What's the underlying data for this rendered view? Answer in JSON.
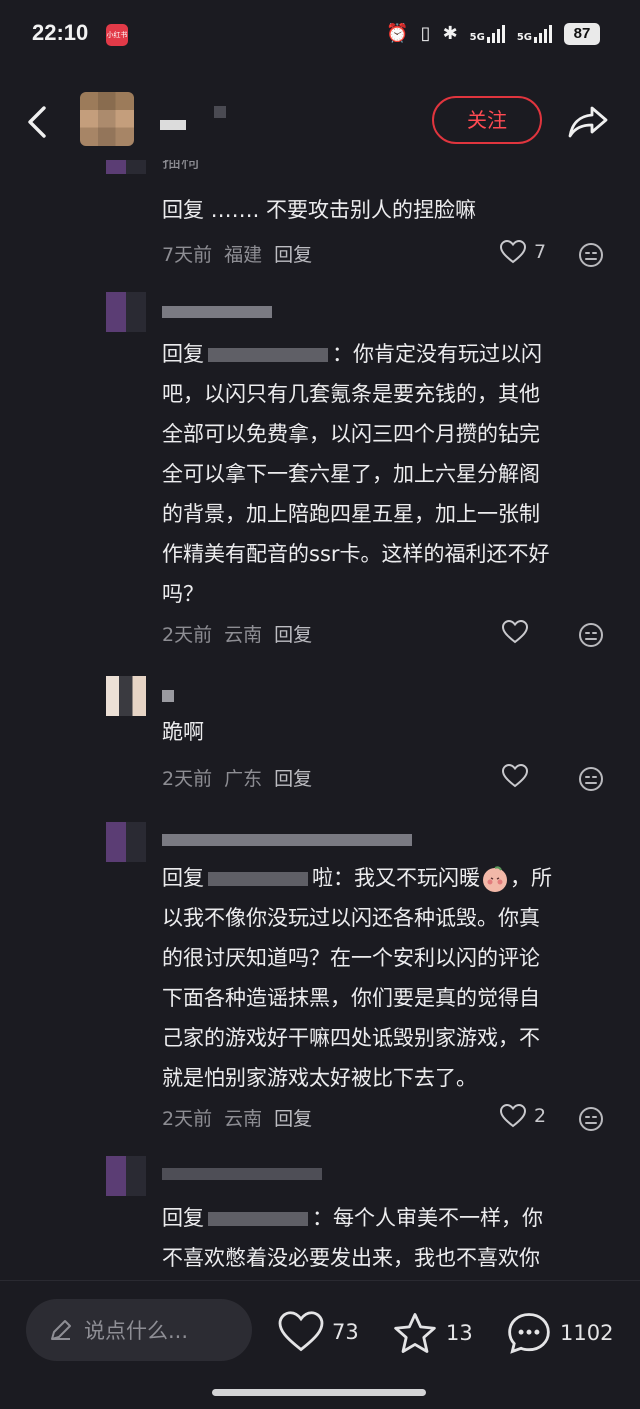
{
  "status_bar": {
    "time": "22:10",
    "app_badge": "小红书",
    "network_1": "5G",
    "network_2": "5G",
    "battery": "87"
  },
  "header": {
    "follow_label": "关注"
  },
  "comments": [
    {
      "name_partial": "插椅",
      "text": "回复 ……. 不要攻击别人的捏脸嘛",
      "time": "7天前",
      "region": "福建",
      "reply_label": "回复",
      "likes": "7"
    },
    {
      "reply_prefix": "回复",
      "reply_suffix": "：你肯定没有玩过以闪",
      "text_lines": [
        "吧，以闪只有几套氪条是要充钱的，其他",
        "全部可以免费拿，以闪三四个月攒的钻完",
        "全可以拿下一套六星了，加上六星分解阁",
        "的背景，加上陪跑四星五星，加上一张制",
        "作精美有配音的ssr卡。这样的福利还不好",
        "吗？"
      ],
      "time": "2天前",
      "region": "云南",
      "reply_label": "回复",
      "likes": ""
    },
    {
      "text": "跪啊",
      "time": "2天前",
      "region": "广东",
      "reply_label": "回复",
      "likes": ""
    },
    {
      "reply_prefix": "回复",
      "reply_suffix": "啦：我又不玩闪暖",
      "reply_tail": "，所",
      "text_lines": [
        "以我不像你没玩过以闪还各种诋毁。你真",
        "的很讨厌知道吗？在一个安利以闪的评论",
        "下面各种造谣抹黑，你们要是真的觉得自",
        "己家的游戏好干嘛四处诋毁别家游戏，不",
        "就是怕别家游戏太好被比下去了。"
      ],
      "time": "2天前",
      "region": "云南",
      "reply_label": "回复",
      "likes": "2"
    },
    {
      "reply_prefix": "回复",
      "reply_suffix": "：每个人审美不一样，你",
      "text_lines": [
        "不喜欢憋着没必要发出来，我也不喜欢你"
      ]
    }
  ],
  "bottom_bar": {
    "input_placeholder": "说点什么...",
    "like_count": "73",
    "star_count": "13",
    "comment_count": "1102"
  },
  "colors": {
    "background": "#1b1b21",
    "accent": "#ff4a52",
    "meta_text": "#8d8d93"
  }
}
